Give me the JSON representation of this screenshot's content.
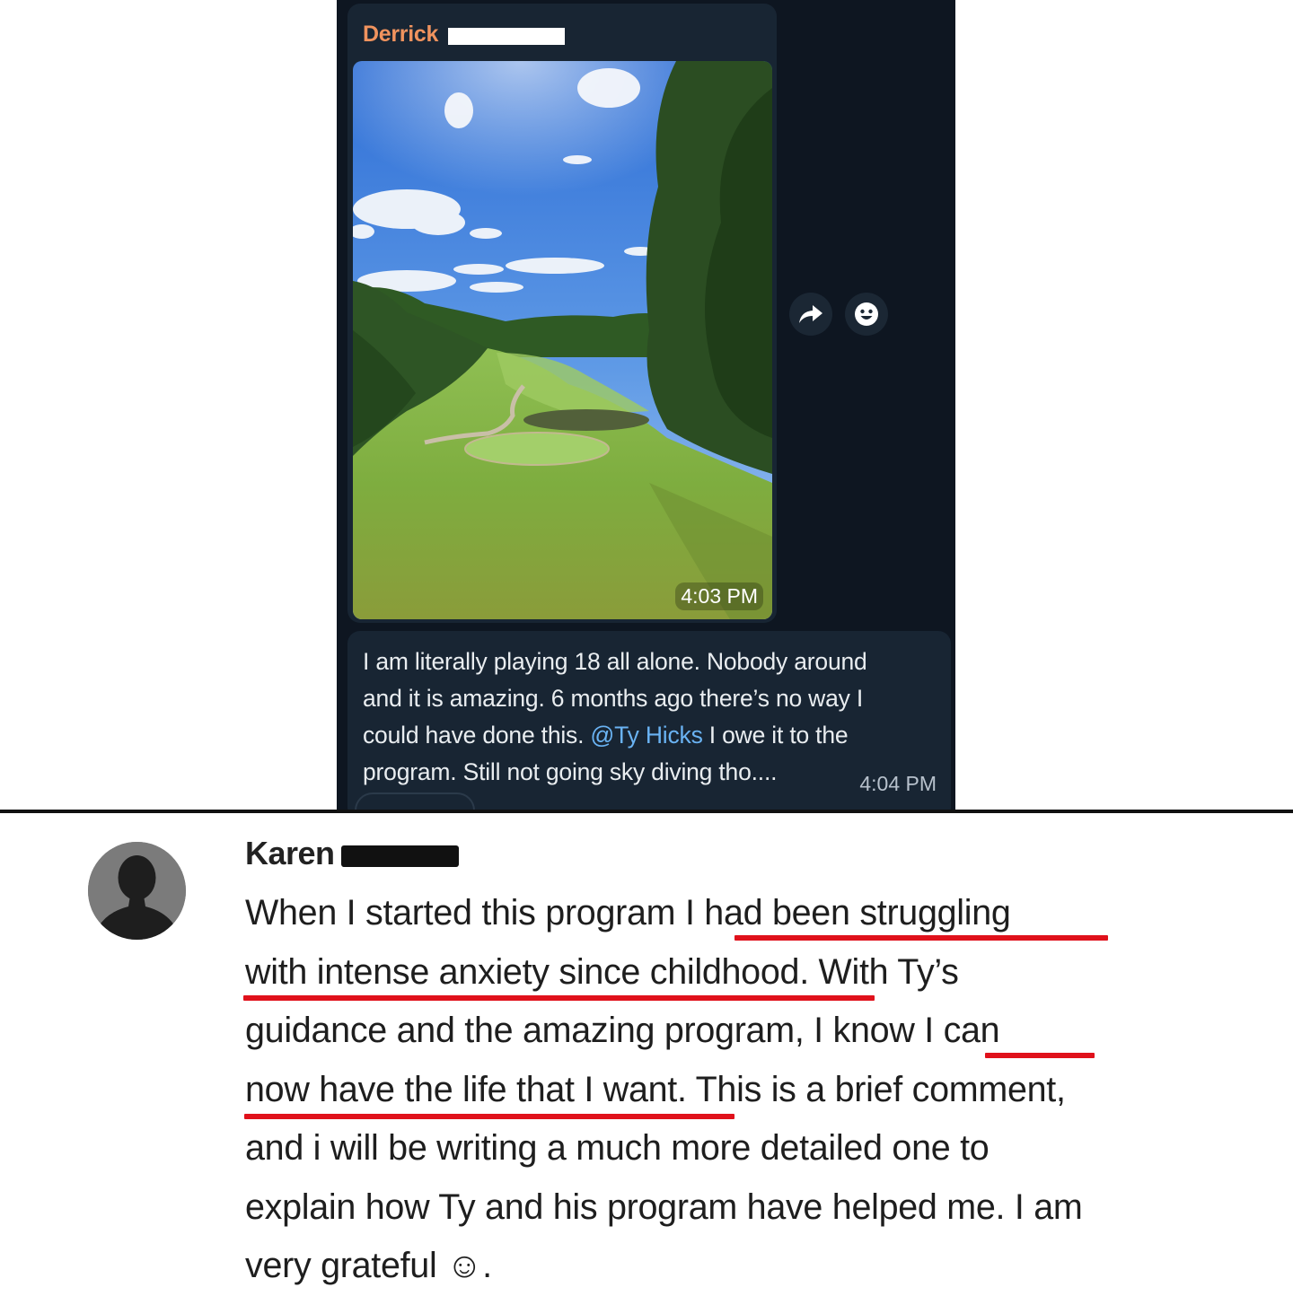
{
  "chat": {
    "sender_name": "Derrick",
    "photo_time": "4:03 PM",
    "message_lines": [
      "I am literally playing 18 all alone. Nobody around",
      "and it is amazing. 6 months ago there’s no way I"
    ],
    "line3_before": "could have done this. ",
    "mention": "@Ty Hicks",
    "line3_after": " I owe it to the",
    "line4": "program. Still not going sky diving tho....",
    "message_time": "4:04 PM",
    "icons": {
      "forward": "forward-icon",
      "react": "smiley-icon"
    },
    "colors": {
      "background": "#0e1621",
      "bubble": "#182533",
      "sender": "#f0935e",
      "mention": "#6ab3f3"
    }
  },
  "comment": {
    "author": "Karen",
    "lines": [
      "When I started this program I had been struggling",
      "with intense anxiety since childhood. With Ty’s",
      "guidance and the amazing program, I know I can",
      "now have the life that I want. This is a brief comment,",
      "and i will be writing a much more detailed one to",
      "explain how Ty and his program have helped me. I am",
      "very grateful ☺."
    ],
    "underline_color": "#e0111b"
  }
}
